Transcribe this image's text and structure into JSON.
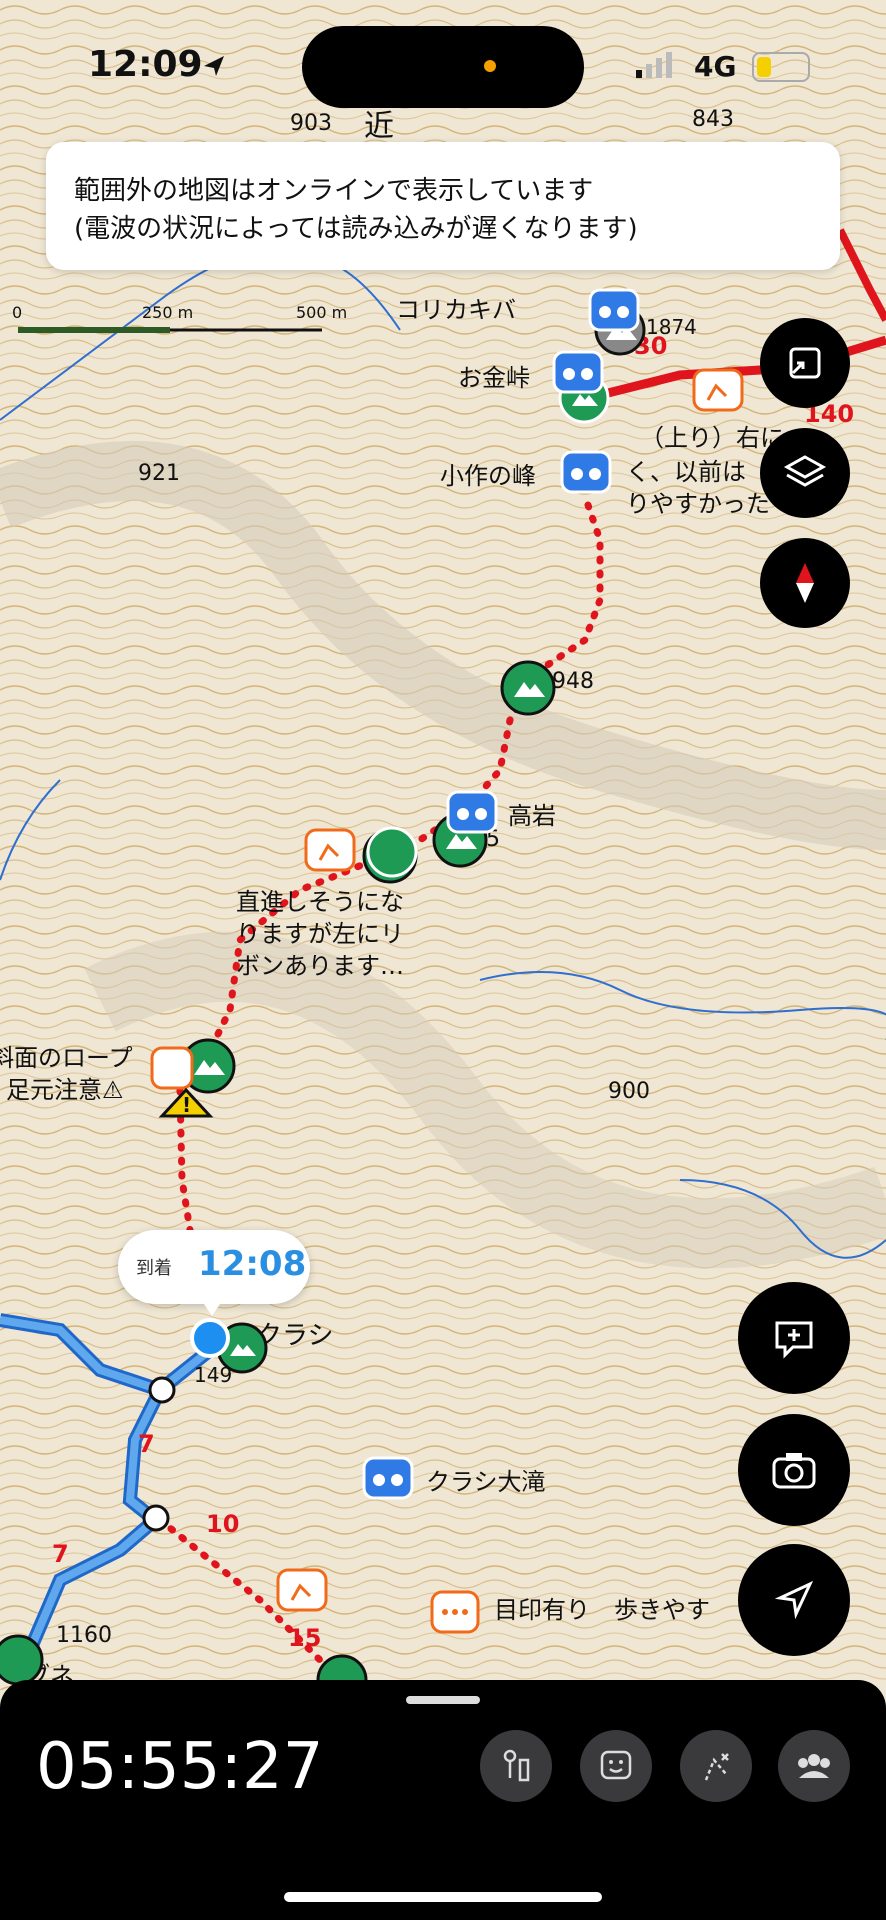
{
  "status_bar": {
    "time": "12:09",
    "network": "4G"
  },
  "notice": {
    "line1": "範囲外の地図はオンラインで表示しています",
    "line2": "(電波の状況によっては読み込みが遅くなります)"
  },
  "scale": {
    "t0": "0",
    "t1": "250 m",
    "t2": "500 m"
  },
  "map": {
    "peaks": [
      "903",
      "843",
      "921",
      "948",
      "900",
      "1160",
      "1874",
      "149",
      "165"
    ],
    "places": {
      "korikakiba": "コリカキバ",
      "okanetoge": "お金峠",
      "kosaku": "小作の峰",
      "takaiwa": "高岩",
      "kurashi": "クラシ",
      "kurashi_otaki": "クラシ大滝",
      "ibune": "イブネ",
      "top_char": "近"
    },
    "notes": {
      "up_right_1": "（上り）右に",
      "up_right_2": "く、以前は",
      "up_right_3": "りやすかった",
      "straight_1": "直進しそうにな",
      "straight_2": "りますが左にリ",
      "straight_3": "ボンあります…",
      "rope_1": "斜面のロープ",
      "rope_2": "足元注意⚠",
      "mark": "目印有り　歩きやす"
    },
    "route_numbers": [
      "30",
      "140",
      "7",
      "10",
      "15",
      "7"
    ]
  },
  "arrival": {
    "label": "到着",
    "time": "12:08"
  },
  "bottom": {
    "elapsed": "05:55:27"
  },
  "colors": {
    "route_red": "#e0141c",
    "trail_blue": "#2a7fd4",
    "peak_green": "#1e9a55",
    "warn_yellow": "#f4d000",
    "accent_orange": "#f06a1a"
  }
}
